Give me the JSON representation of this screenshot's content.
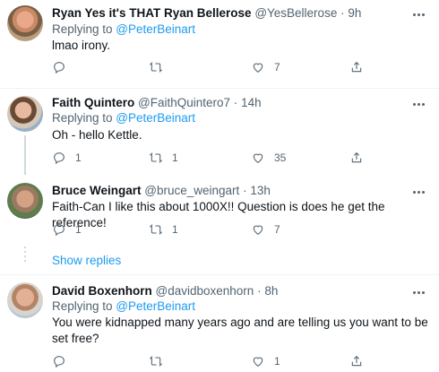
{
  "tweets": [
    {
      "name": "Ryan Yes it's THAT Ryan Bellerose",
      "handle": "@YesBellerose",
      "dot": "·",
      "time": "9h",
      "replying_prefix": "Replying to ",
      "replying_to": "@PeterBeinart",
      "text": "lmao irony.",
      "replies": "",
      "retweets": "",
      "likes": "7"
    },
    {
      "name": "Faith Quintero",
      "handle": "@FaithQuintero7",
      "dot": "·",
      "time": "14h",
      "replying_prefix": "Replying to ",
      "replying_to": "@PeterBeinart",
      "text": "Oh - hello Kettle.",
      "replies": "1",
      "retweets": "1",
      "likes": "35"
    },
    {
      "name": "Bruce Weingart",
      "handle": "@bruce_weingart",
      "dot": "·",
      "time": "13h",
      "text": "Faith-Can I like this about 1000X!! Question is does he get the reference!",
      "replies": "1",
      "retweets": "1",
      "likes": "7"
    },
    {
      "name": "David Boxenhorn",
      "handle": "@davidboxenhorn",
      "dot": "·",
      "time": "8h",
      "replying_prefix": "Replying to ",
      "replying_to": "@PeterBeinart",
      "text": "You were kidnapped many years ago and are telling us you want to be set free?",
      "replies": "",
      "retweets": "",
      "likes": "1"
    }
  ],
  "show_replies": "Show replies",
  "icons": {
    "reply": "reply-icon",
    "retweet": "retweet-icon",
    "like": "heart-icon",
    "share": "share-icon",
    "more": "more-icon"
  },
  "colors": {
    "link": "#1d9bf0",
    "secondary_text": "#536471",
    "primary_text": "#0f1419"
  }
}
